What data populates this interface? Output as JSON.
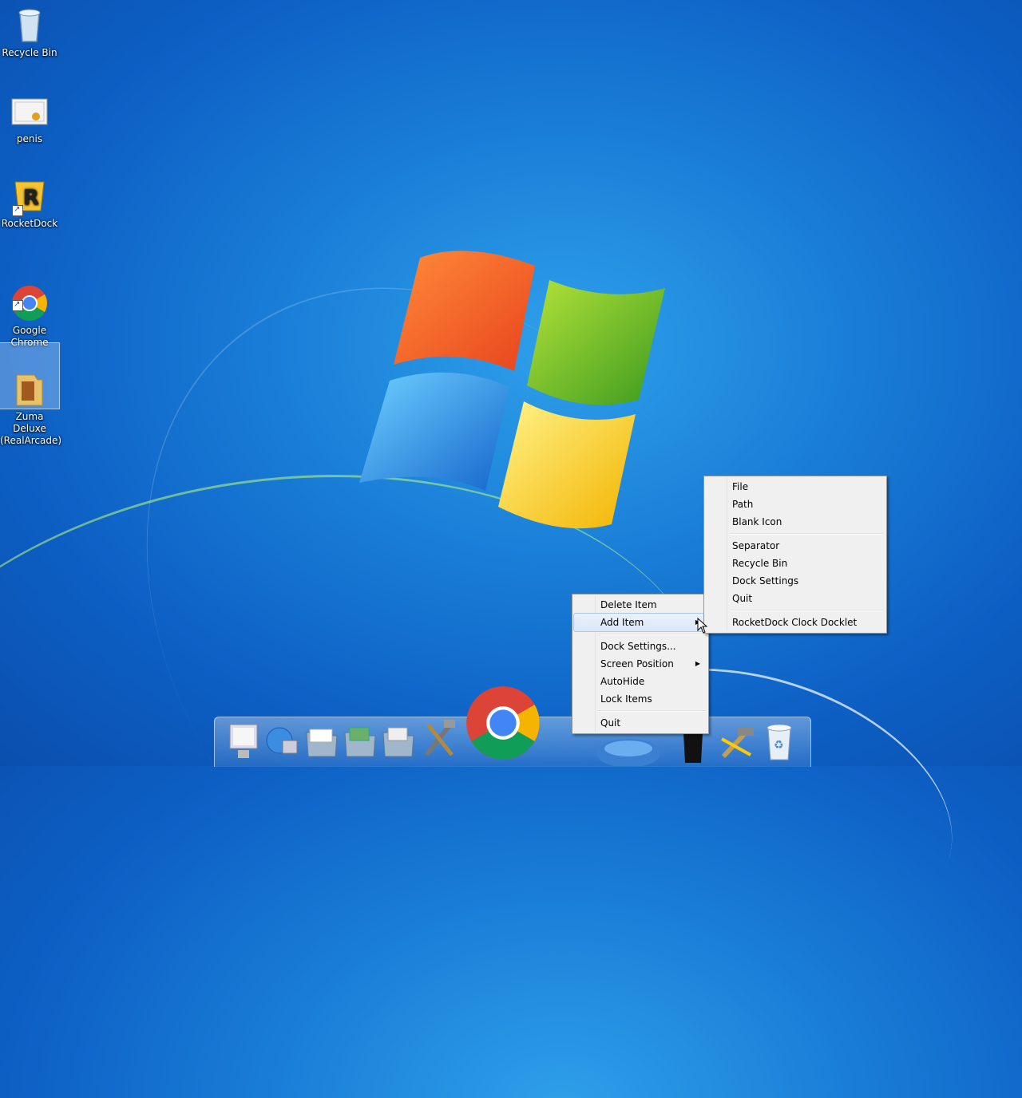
{
  "desktop": {
    "icons": [
      {
        "label": "Recycle Bin"
      },
      {
        "label": "penis"
      },
      {
        "label": "RocketDock"
      },
      {
        "label": "Google\nChrome"
      },
      {
        "label": "Zuma Deluxe\n(RealArcade)"
      }
    ]
  },
  "dock_menu": {
    "items": [
      {
        "label": "Delete Item"
      },
      {
        "label": "Add Item"
      },
      {
        "label": "Dock Settings..."
      },
      {
        "label": "Screen Position"
      },
      {
        "label": "AutoHide"
      },
      {
        "label": "Lock Items"
      },
      {
        "label": "Quit"
      }
    ]
  },
  "add_item_submenu": {
    "items": [
      {
        "label": "File"
      },
      {
        "label": "Path"
      },
      {
        "label": "Blank Icon"
      },
      {
        "label": "Separator"
      },
      {
        "label": "Recycle Bin"
      },
      {
        "label": "Dock Settings"
      },
      {
        "label": "Quit"
      },
      {
        "label": "RocketDock Clock Docklet"
      }
    ]
  },
  "dock": {
    "icons": [
      "monitor-icon",
      "network-icon",
      "folder-icon",
      "folder-icon",
      "folder-icon",
      "tools-icon",
      "chrome-icon",
      "globe-icon",
      "ink-icon",
      "hammer-icon",
      "recycle-bin-icon"
    ]
  },
  "colors": {
    "desktop_bg": "#1a7fd8",
    "menu_bg": "#f0f0f0",
    "highlight": "#d9e7f7"
  }
}
